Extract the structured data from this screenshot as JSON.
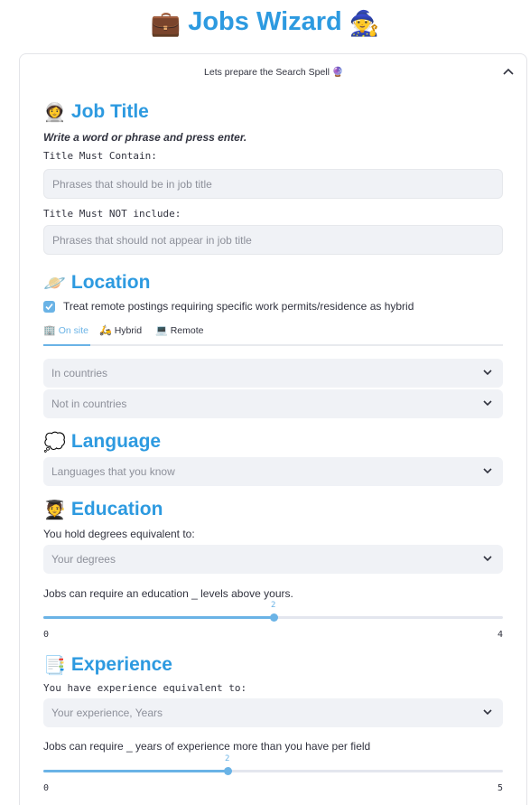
{
  "app": {
    "title": "Jobs Wizard",
    "left_emoji": "💼",
    "right_emoji": "🧙"
  },
  "expander": {
    "label": "Lets prepare the Search Spell",
    "label_emoji": "🔮",
    "state": "expanded"
  },
  "job_title": {
    "heading": "Job Title",
    "emoji": "👩‍🚀",
    "hint": "Write a word or phrase and press enter.",
    "must_contain_label": "Title Must Contain:",
    "must_contain_placeholder": "Phrases that should be in job title",
    "must_not_label": "Title Must NOT include:",
    "must_not_placeholder": "Phrases that should not appear in job title"
  },
  "location": {
    "heading": "Location",
    "emoji": "🪐",
    "checkbox_label": "Treat remote postings requiring specific work permits/residence as hybrid",
    "checkbox_checked": true,
    "tabs": [
      {
        "label": "On site",
        "emoji": "🏢",
        "active": true
      },
      {
        "label": "Hybrid",
        "emoji": "🛵",
        "active": false
      },
      {
        "label": "Remote",
        "emoji": "💻",
        "active": false
      }
    ],
    "in_countries_placeholder": "In countries",
    "not_in_countries_placeholder": "Not in countries"
  },
  "language": {
    "heading": "Language",
    "emoji": "💭",
    "placeholder": "Languages that you know"
  },
  "education": {
    "heading": "Education",
    "emoji": "🧑‍🎓",
    "degrees_label": "You hold degrees equivalent to:",
    "degrees_placeholder": "Your degrees",
    "slider_label": "Jobs can require an education _ levels above yours.",
    "slider": {
      "min": "0",
      "max": "4",
      "value": "2"
    }
  },
  "experience": {
    "heading": "Experience",
    "emoji": "📑",
    "experience_label": "You have experience equivalent to:",
    "experience_placeholder": "Your experience, Years",
    "slider_label": "Jobs can require _ years of experience more than you have per field",
    "slider": {
      "min": "0",
      "max": "5",
      "value": "2"
    }
  },
  "colors": {
    "accent": "#2d9ae0",
    "slider": "#6ab3e6",
    "input_bg": "#f0f2f6",
    "text": "#31333f",
    "placeholder": "#8d909a"
  }
}
